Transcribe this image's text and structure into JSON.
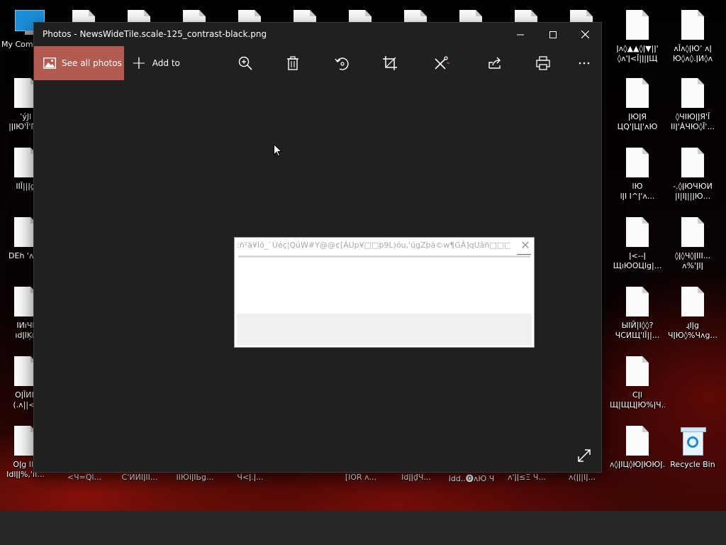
{
  "window": {
    "title": "Photos - NewsWideTile.scale-125_contrast-black.png"
  },
  "toolbar": {
    "see_all_label": "See all photos",
    "add_to_label": "Add to",
    "buttons": [
      "zoom-in",
      "delete",
      "rotate",
      "crop",
      "edit-and-create",
      "share",
      "print",
      "more"
    ]
  },
  "dialog": {
    "title": ":ñ²ä¥Iô_`Úéç¦QúW#Y@@¢[ÁUp¥□□þ9L)óu,'úgZþá©w¶GÂ]qUâñ□□□□;..."
  },
  "desktop": {
    "left_icons": [
      {
        "label": "My Com"
      },
      {
        "label": "ʼýJl\n|ǀIЮ'Ǐ'ПИ"
      },
      {
        "label": "IIǏ||ǀg"
      },
      {
        "label": "DЕh 'ʌǀ<"
      },
      {
        "label": "IИıЧI\nıdǀIĶ◊"
      },
      {
        "label": "ОǀǏИIǀ\n(.ʌ||<)"
      },
      {
        "label": "Оǀg Ilǀǀ\nIdlǀǀ%,'II..."
      }
    ],
    "bottom_labels": [
      "<Ч=Ql...",
      "C'ИИIǀII...",
      "IIЮlǀIЬg...",
      "Ч<ǀ.ǀ...",
      "[ΙОR ʌ...",
      "Іdǀǀ₫Ч...",
      "Іdd..⓿ʌЮ Ч",
      "ʌ'ǀǀ≤Ξ Ч...",
      "ʌ(ǀǀ|Ιǀ..."
    ],
    "col1_icons": [
      {
        "label": "ǀʌ◊▲▲◊ǀ▼|ǀ'\n◊ʌ'ǀ<Ǐ|ǀ|ǀЩ"
      },
      {
        "label": "ǀЮǀЯ\nЦQ'ǀЦǀ'ʌЮ"
      },
      {
        "label": "lЮ\nlǀI Ι^ǀ'ʌ..."
      },
      {
        "label": "ǀ<--ǀ\nЩıЮОЦlg|..."
      },
      {
        "label": "ЫΙЙ|I◊◊?\nЧСИЩ'lǏ||..."
      },
      {
        "label": "Сǀl\nЩ|ЩЦǀЮ%ǀЧ..."
      },
      {
        "label": "ʌ◊ǀIЦ◊ЮǀЮЮǀ..."
      }
    ],
    "col2_icons": [
      {
        "label": "ʌǏʌ◊ǀЮʼ ʌǀ\nЮ◊ʌ◊.ǀИ◊ʌ"
      },
      {
        "label": "◊ЧIЮǀǀЯ'Ǐ\nIIǀ'ÀЧЮ◊Ǐ'..."
      },
      {
        "label": "-.◊ǀЮЧЮИ\n|Ι|Iǀ||ǀЮ..."
      },
      {
        "label": "◊ǀ◊Ч◊ǀIII...\nʌ%'ǀIǀ"
      },
      {
        "label": "ɻIǀg\nЧǀЮ◊%Чʌg..."
      },
      {
        "label": "Recycle Bin"
      }
    ]
  },
  "colors": {
    "accent": "#b35a51",
    "window_bg": "#202020",
    "taskbar": "#262626"
  }
}
